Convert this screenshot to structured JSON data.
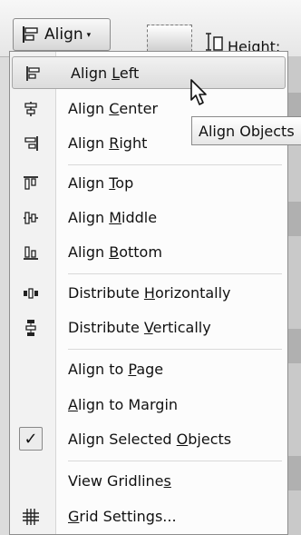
{
  "ribbon": {
    "align_label": "Align",
    "dropdown_glyph": "▾",
    "height_label": "Height:"
  },
  "tooltip": "Align Objects",
  "menu": {
    "items": [
      {
        "pre": "Align ",
        "ul": "L",
        "post": "eft",
        "icon": "align-left-icon",
        "hover": true
      },
      {
        "pre": "Align ",
        "ul": "C",
        "post": "enter",
        "icon": "align-center-icon"
      },
      {
        "pre": "Align ",
        "ul": "R",
        "post": "ight",
        "icon": "align-right-icon"
      },
      {
        "pre": "Align ",
        "ul": "T",
        "post": "op",
        "icon": "align-top-icon"
      },
      {
        "pre": "Align ",
        "ul": "M",
        "post": "iddle",
        "icon": "align-middle-icon"
      },
      {
        "pre": "Align ",
        "ul": "B",
        "post": "ottom",
        "icon": "align-bottom-icon"
      },
      {
        "pre": "Distribute ",
        "ul": "H",
        "post": "orizontally",
        "icon": "distribute-horizontally-icon"
      },
      {
        "pre": "Distribute ",
        "ul": "V",
        "post": "ertically",
        "icon": "distribute-vertically-icon"
      },
      {
        "pre": "Align to ",
        "ul": "P",
        "post": "age",
        "icon": ""
      },
      {
        "pre": "",
        "ul": "A",
        "post": "lign to Margin",
        "icon": ""
      },
      {
        "pre": "Align Selected ",
        "ul": "O",
        "post": "bjects",
        "icon": "checkmark-icon",
        "checked": true
      },
      {
        "pre": "View Gridline",
        "ul": "s",
        "post": "",
        "icon": ""
      },
      {
        "pre": "",
        "ul": "G",
        "post": "rid Settings...",
        "icon": "grid-icon"
      }
    ]
  },
  "check_glyph": "✓"
}
